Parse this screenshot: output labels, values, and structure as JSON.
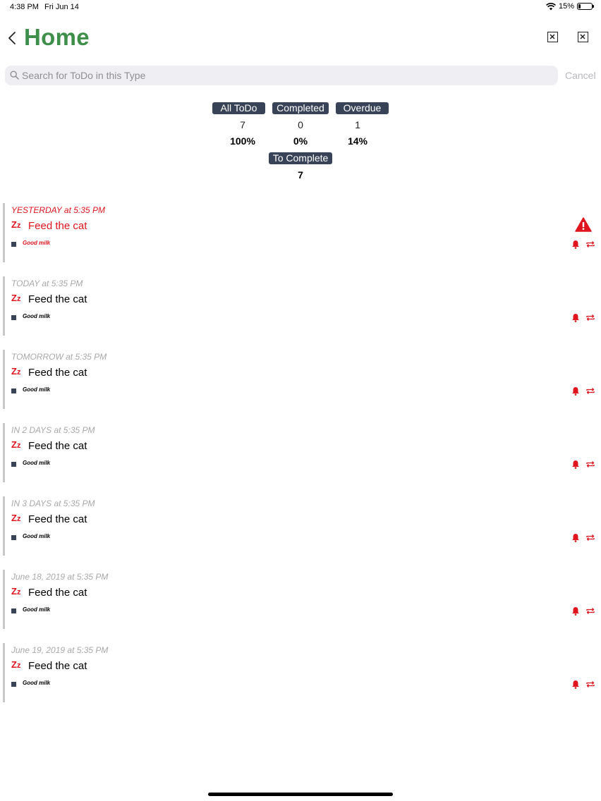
{
  "status_bar": {
    "time": "4:38 PM",
    "date": "Fri Jun 14",
    "battery": "15%"
  },
  "header": {
    "title": "Home",
    "back_icon": "chevron-left-icon"
  },
  "search": {
    "placeholder": "Search for ToDo in this Type",
    "cancel_label": "Cancel"
  },
  "stats": {
    "all": {
      "label": "All ToDo",
      "count": "7",
      "percent": "100%"
    },
    "completed": {
      "label": "Completed",
      "count": "0",
      "percent": "0%"
    },
    "overdue": {
      "label": "Overdue",
      "count": "1",
      "percent": "14%"
    },
    "to_complete": {
      "label": "To Complete",
      "count": "7"
    }
  },
  "todos": [
    {
      "date": "YESTERDAY at 5:35 PM",
      "title": "Feed the cat",
      "note": "Good milk",
      "overdue": true
    },
    {
      "date": "TODAY at 5:35 PM",
      "title": "Feed the cat",
      "note": "Good milk",
      "overdue": false
    },
    {
      "date": "TOMORROW at 5:35 PM",
      "title": "Feed the cat",
      "note": "Good milk",
      "overdue": false
    },
    {
      "date": "IN 2 DAYS at 5:35 PM",
      "title": "Feed the cat",
      "note": "Good milk",
      "overdue": false
    },
    {
      "date": "IN 3 DAYS at 5:35 PM",
      "title": "Feed the cat",
      "note": "Good milk",
      "overdue": false
    },
    {
      "date": "June 18, 2019 at 5:35 PM",
      "title": "Feed the cat",
      "note": "Good milk",
      "overdue": false
    },
    {
      "date": "June 19, 2019 at 5:35 PM",
      "title": "Feed the cat",
      "note": "Good milk",
      "overdue": false
    }
  ],
  "colors": {
    "title_green": "#3e8f4a",
    "pill_bg": "#394357",
    "alert_red": "#e0141e"
  }
}
